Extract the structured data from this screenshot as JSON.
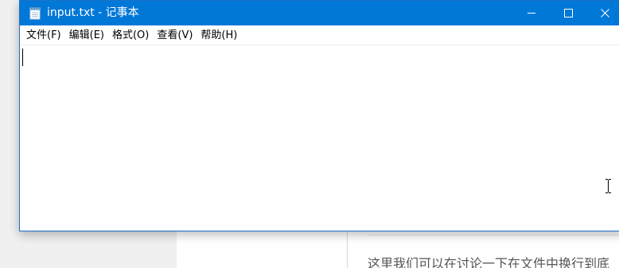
{
  "window": {
    "title": "input.txt - 记事本"
  },
  "menubar": {
    "items": [
      {
        "label": "文件(F)"
      },
      {
        "label": "编辑(E)"
      },
      {
        "label": "格式(O)"
      },
      {
        "label": "查看(V)"
      },
      {
        "label": "帮助(H)"
      }
    ]
  },
  "editor": {
    "content": ""
  },
  "background_page": {
    "paragraph": "这里我们可以在讨论一下在文件中换行到底"
  },
  "colors": {
    "titlebar": "#0078d7",
    "window_border": "#1e6fc8"
  },
  "icons": {
    "app": "notepad-icon",
    "minimize": "minimize-icon",
    "maximize": "maximize-icon",
    "close": "close-icon",
    "cursor": "i-beam-cursor-icon"
  }
}
